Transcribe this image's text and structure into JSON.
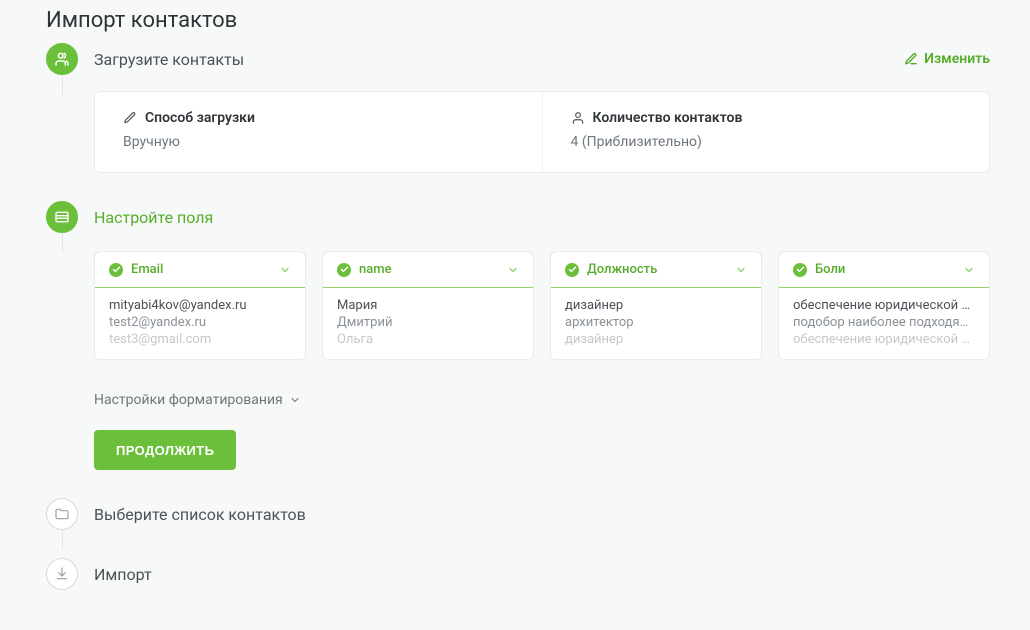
{
  "page": {
    "title": "Импорт контактов"
  },
  "actions": {
    "edit": "Изменить"
  },
  "steps": {
    "upload": {
      "title": "Загрузите контакты",
      "col1": {
        "label": "Способ загрузки",
        "value": "Вручную"
      },
      "col2": {
        "label": "Количество контактов",
        "value": "4 (Приблизительно)"
      }
    },
    "configure": {
      "title": "Настройте поля",
      "formatting_toggle": "Настройки форматирования",
      "continue": "ПРОДОЛЖИТЬ",
      "fields": [
        {
          "name": "Email",
          "samples": [
            "mityabi4kov@yandex.ru",
            "test2@yandex.ru",
            "test3@gmail.com"
          ]
        },
        {
          "name": "name",
          "samples": [
            "Мария",
            "Дмитрий",
            "Ольга"
          ]
        },
        {
          "name": "Должность",
          "samples": [
            "дизайнер",
            "архитектор",
            "дизайнер"
          ]
        },
        {
          "name": "Боли",
          "samples": [
            "обеспечение юридической бе…",
            "подобор наиболее подходящ…",
            "обеспечение юридической бе…"
          ]
        }
      ]
    },
    "selectList": {
      "title": "Выберите список контактов"
    },
    "import": {
      "title": "Импорт"
    }
  }
}
